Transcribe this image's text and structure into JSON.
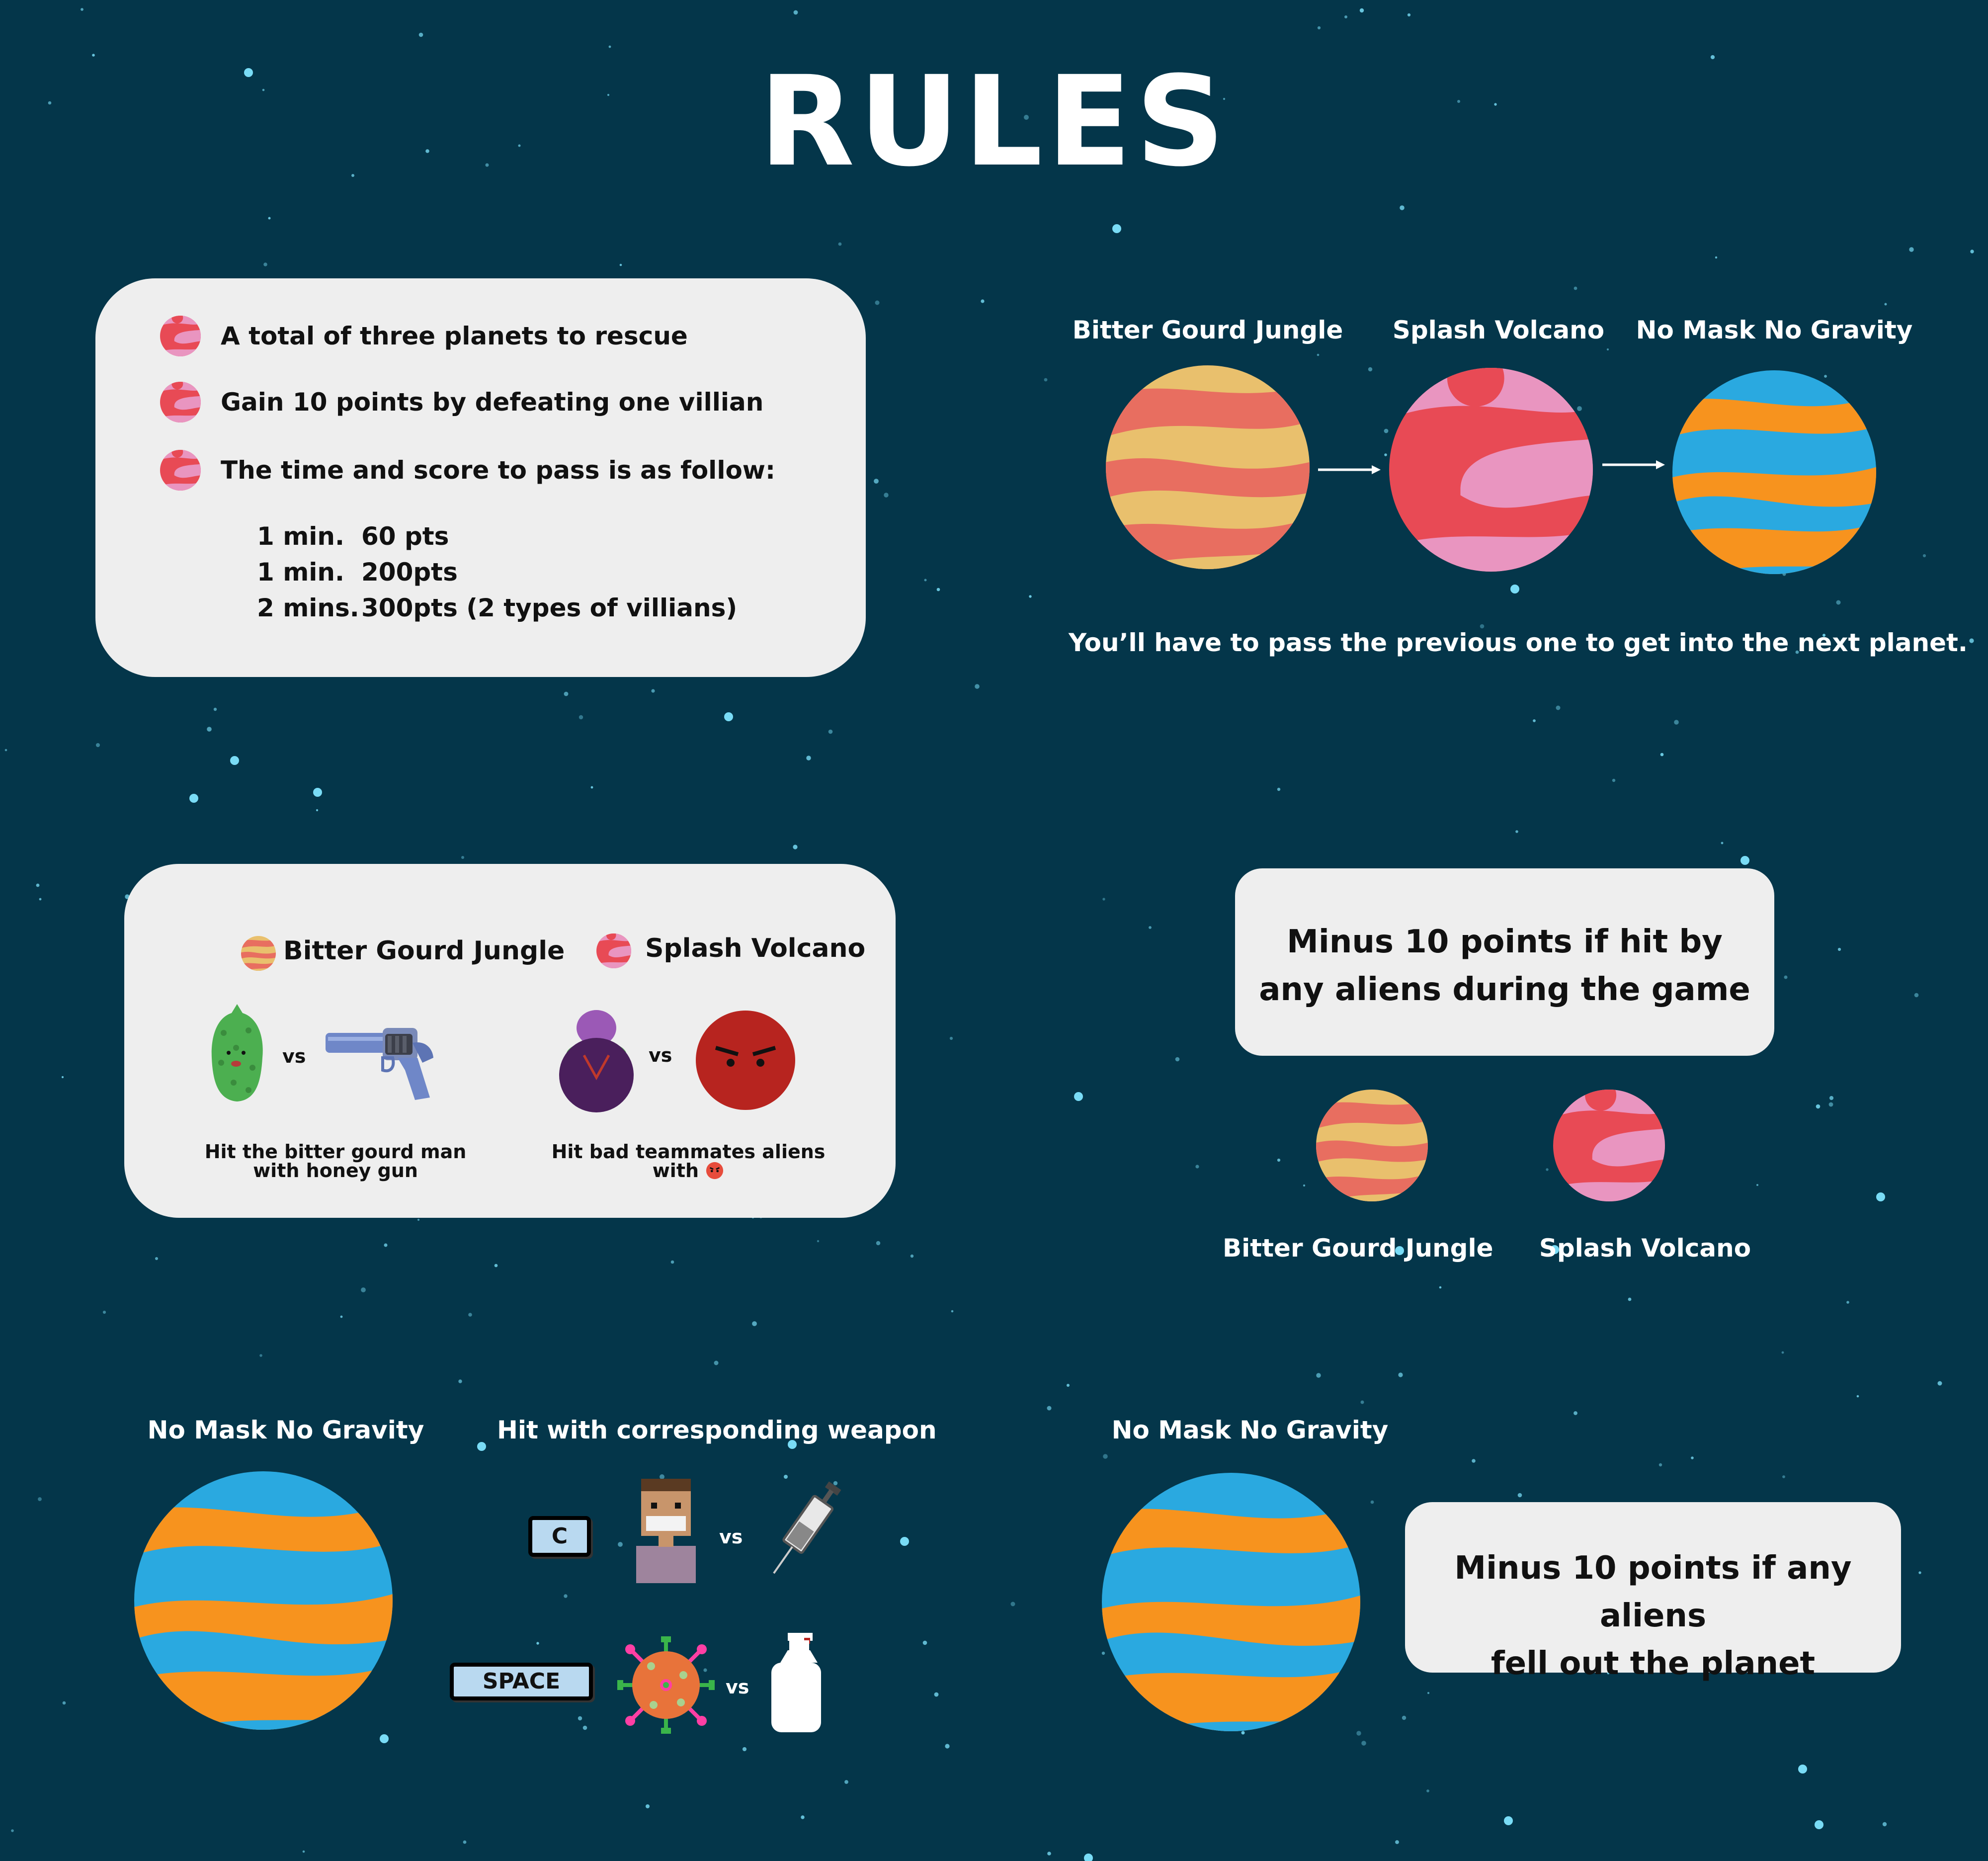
{
  "title": "RULES",
  "rules_card": {
    "items": [
      "A total of three planets to rescue",
      "Gain 10 points by defeating one villian",
      "The time and score to pass is as follow:"
    ],
    "table": [
      {
        "time": "1 min.",
        "score": "60 pts"
      },
      {
        "time": "1 min.",
        "score": "200pts"
      },
      {
        "time": "2 mins.",
        "score": "300pts (2 types of villians)"
      }
    ]
  },
  "planet_sequence": {
    "planets": [
      "Bitter Gourd Jungle",
      "Splash Volcano",
      "No Mask No Gravity"
    ],
    "note": "You’ll have to pass the previous one to get into the next planet."
  },
  "weapons_card": {
    "left": {
      "name": "Bitter Gourd Jungle",
      "vs": "vs",
      "caption_line1": "Hit the bitter gourd man",
      "caption_line2": "with honey gun"
    },
    "right": {
      "name": "Splash Volcano",
      "vs": "vs",
      "caption_line1": "Hit bad teammates aliens",
      "caption_line2": "with"
    }
  },
  "penalty_hit": {
    "line1": "Minus 10 points if hit by",
    "line2": "any aliens during the game",
    "planets": [
      "Bitter Gourd Jungle",
      "Splash Volcano"
    ]
  },
  "nomask_section": {
    "planet_name": "No Mask No Gravity",
    "heading": "Hit with corresponding weapon",
    "keys": [
      "C",
      "SPACE"
    ],
    "vs": "vs"
  },
  "penalty_fall": {
    "planet_name": "No Mask No Gravity",
    "line1": "Minus 10 points if  any aliens",
    "line2": "fell out the planet"
  },
  "colors": {
    "background": "#04364a",
    "card": "#eeeeee",
    "star": "#7fe6ff",
    "gourd_orange": "#e9c06d",
    "gourd_red": "#e86e60",
    "volcano_red": "#e84a55",
    "volcano_pink": "#e995c0",
    "nomask_blue": "#2aa9e0",
    "nomask_orange": "#f7931e"
  },
  "icons": [
    "planet-icon",
    "bitter-gourd-man-icon",
    "honey-gun-icon",
    "eggplant-alien-icon",
    "angry-face-icon",
    "masked-person-icon",
    "syringe-icon",
    "virus-icon",
    "spray-bottle-icon"
  ]
}
